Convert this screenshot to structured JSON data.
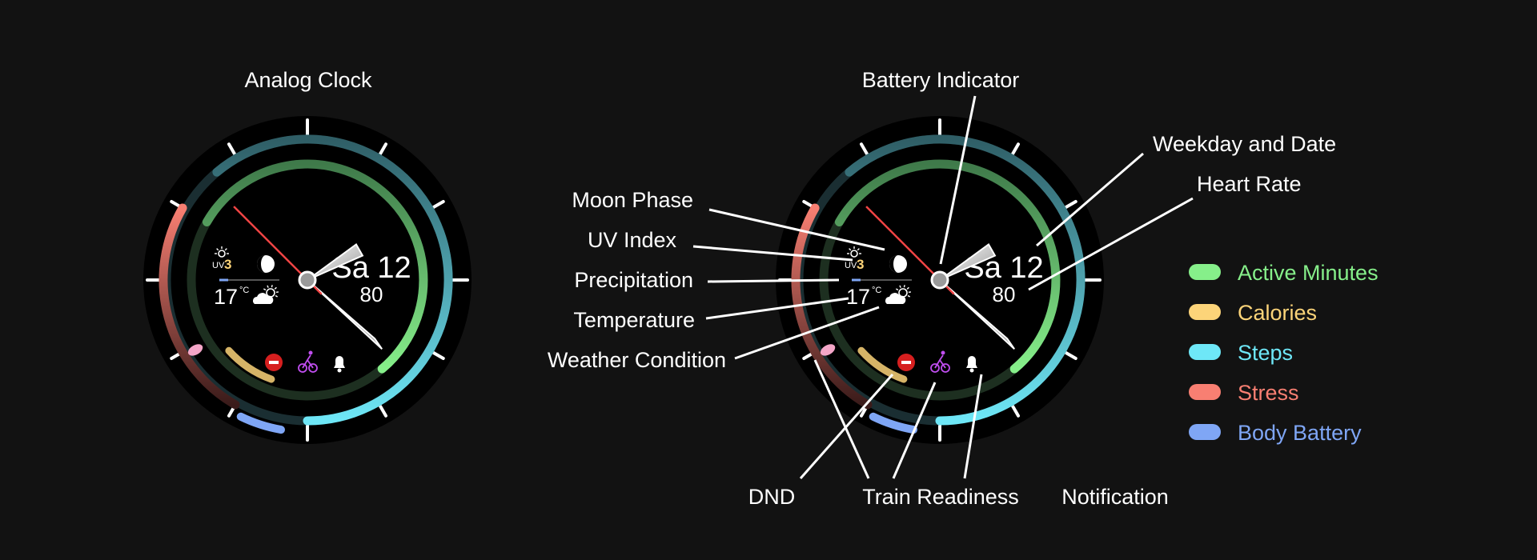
{
  "left_title": "Analog Clock",
  "watch": {
    "date": "Sa 12",
    "heart_rate": "80",
    "uv_label": "UV",
    "uv_value": "3",
    "temperature": "17",
    "temp_unit": "°C"
  },
  "annotations": {
    "battery_indicator": "Battery Indicator",
    "weekday_and_date": "Weekday and Date",
    "heart_rate": "Heart Rate",
    "moon_phase": "Moon Phase",
    "uv_index": "UV Index",
    "precipitation": "Precipitation",
    "temperature": "Temperature",
    "weather_condition": "Weather Condition",
    "dnd": "DND",
    "train_readiness": "Train Readiness",
    "notification": "Notification"
  },
  "legend": [
    {
      "label": "Active Minutes",
      "color": "#86ef8a"
    },
    {
      "label": "Calories",
      "color": "#fcd479"
    },
    {
      "label": "Steps",
      "color": "#6ee7f7"
    },
    {
      "label": "Stress",
      "color": "#f87f72"
    },
    {
      "label": "Body Battery",
      "color": "#7fa6f5"
    }
  ],
  "colors": {
    "background": "#121212",
    "second_hand": "#ef4444",
    "dnd": "#d61f1f",
    "train_readiness": "#c14ef0",
    "precipitation_bar": "#7fa6f5"
  },
  "icons": [
    "sun-uv-icon",
    "moon-phase-icon",
    "partly-cloudy-icon",
    "dnd-icon",
    "cyclist-check-icon",
    "bell-icon"
  ]
}
